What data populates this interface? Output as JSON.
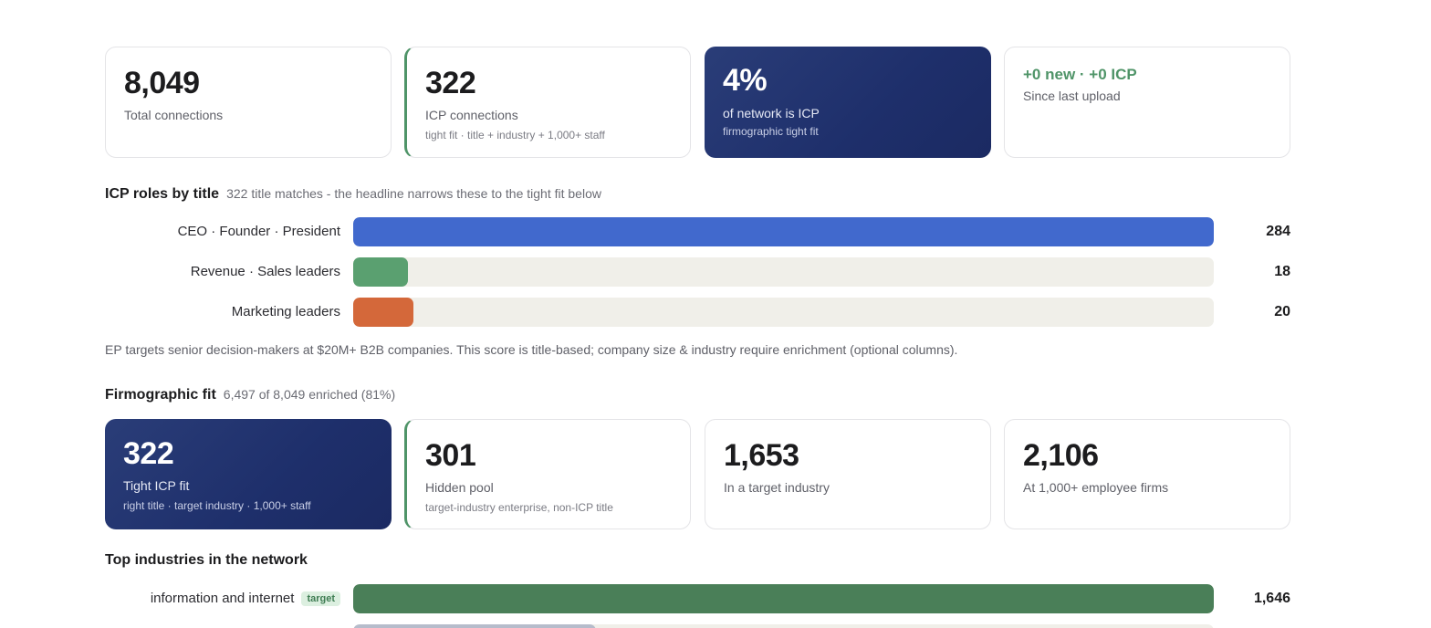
{
  "summary_cards": [
    {
      "value": "8,049",
      "label": "Total connections",
      "sub": ""
    },
    {
      "value": "322",
      "label": "ICP connections",
      "sub": "tight fit · title + industry + 1,000+ staff"
    },
    {
      "value": "4%",
      "label": "of network is ICP",
      "sub": "firmographic tight fit"
    },
    {
      "value": "+0 new · +0 ICP",
      "label": "Since last upload",
      "sub": ""
    }
  ],
  "roles": {
    "title": "ICP roles by title",
    "note": "322 title matches - the headline narrows these to the tight fit below",
    "max": 284,
    "bars": [
      {
        "label": "CEO · Founder · President",
        "value": 284,
        "display": "284",
        "color": "#4169cd"
      },
      {
        "label": "Revenue · Sales leaders",
        "value": 18,
        "display": "18",
        "color": "#5aa070"
      },
      {
        "label": "Marketing leaders",
        "value": 20,
        "display": "20",
        "color": "#d4683a"
      }
    ],
    "footnote": "EP targets senior decision-makers at $20M+ B2B companies. This score is title-based; company size & industry require enrichment (optional columns)."
  },
  "firmographic": {
    "title": "Firmographic fit",
    "note": "6,497 of 8,049 enriched (81%)",
    "cards": [
      {
        "value": "322",
        "label": "Tight ICP fit",
        "sub": "right title · target industry · 1,000+ staff"
      },
      {
        "value": "301",
        "label": "Hidden pool",
        "sub": "target-industry enterprise, non-ICP title"
      },
      {
        "value": "1,653",
        "label": "In a target industry",
        "sub": ""
      },
      {
        "value": "2,106",
        "label": "At 1,000+ employee firms",
        "sub": ""
      }
    ]
  },
  "industries": {
    "title": "Top industries in the network",
    "max": 1646,
    "bars": [
      {
        "label": "information and internet",
        "tag": "target",
        "value": 1646,
        "display": "1,646",
        "color": "#4a7f58"
      },
      {
        "label": "",
        "tag": "",
        "value": 464,
        "display": "",
        "color": "#b6bccb"
      }
    ]
  },
  "colors": {
    "accent_green": "#4f9468",
    "dark_card": "#1e2f6b",
    "track": "#f0efe9"
  }
}
